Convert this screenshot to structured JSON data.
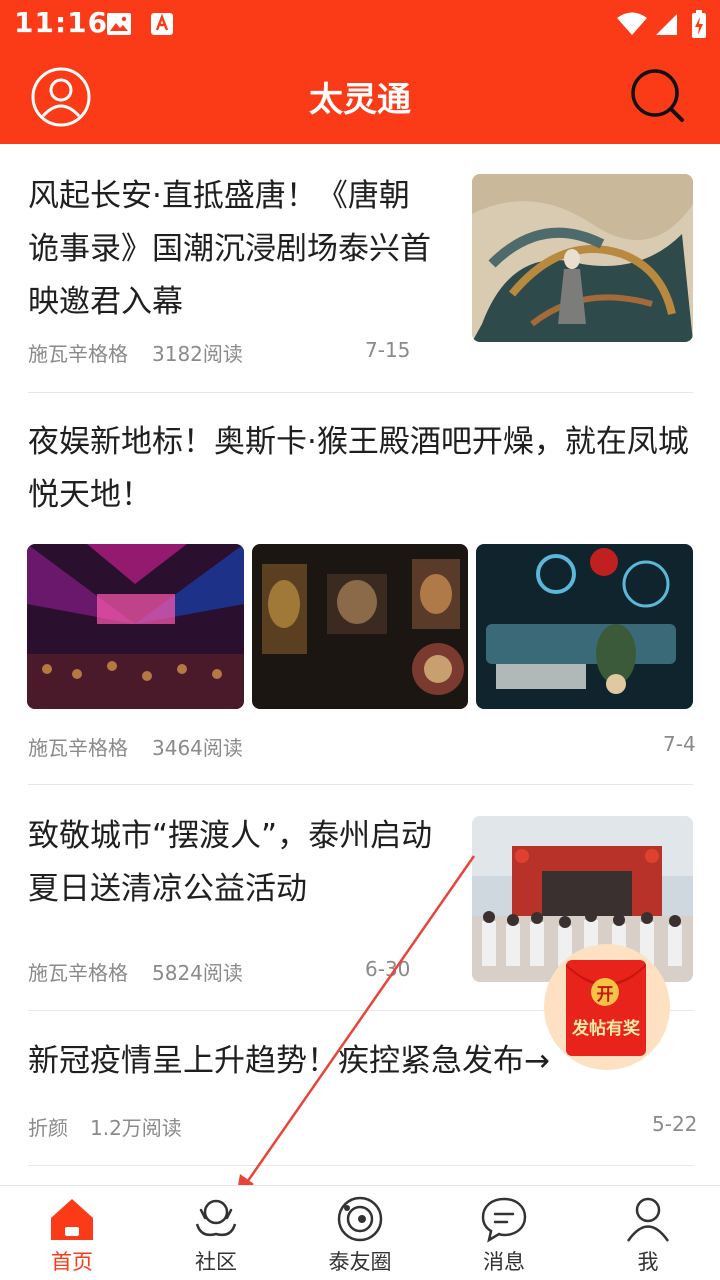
{
  "status_bar": {
    "time": "11:16"
  },
  "header": {
    "title": "太灵通"
  },
  "articles": [
    {
      "title": "风起长安·直抵盛唐！《唐朝诡事录》国潮沉浸剧场泰兴首映邀君入幕",
      "author": "施瓦辛格格",
      "reads": "3182阅读",
      "date": "7-15"
    },
    {
      "title": "夜娱新地标！奥斯卡·猴王殿酒吧开燥，就在凤城悦天地！",
      "author": "施瓦辛格格",
      "reads": "3464阅读",
      "date": "7-4"
    },
    {
      "title": "致敬城市“摆渡人”，泰州启动夏日送清凉公益活动",
      "author": "施瓦辛格格",
      "reads": "5824阅读",
      "date": "6-30"
    },
    {
      "title": "新冠疫情呈上升趋势！疾控紧急发布→",
      "author": "折颜",
      "reads": "1.2万阅读",
      "date": "5-22"
    }
  ],
  "fab": {
    "badge": "开",
    "label": "发帖有奖"
  },
  "tabs": [
    {
      "label": "首页",
      "icon": "home-icon"
    },
    {
      "label": "社区",
      "icon": "community-icon"
    },
    {
      "label": "泰友圈",
      "icon": "circle-icon"
    },
    {
      "label": "消息",
      "icon": "message-icon"
    },
    {
      "label": "我",
      "icon": "profile-icon"
    }
  ],
  "colors": {
    "brand": "#fb3a17",
    "text": "#1f1f1f",
    "meta": "#8a8a8a",
    "annotation_arrow": "#e8443a"
  }
}
